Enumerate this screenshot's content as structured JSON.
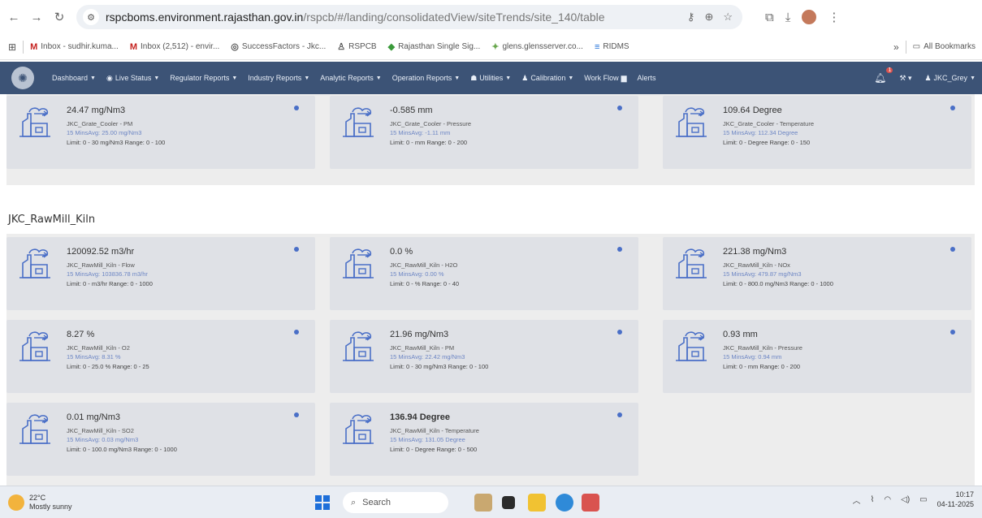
{
  "browser": {
    "url_host": "rspcboms.environment.rajasthan.gov.in",
    "url_path": "/rspcb/#/landing/consolidatedView/siteTrends/site_140/table",
    "bookmarks": [
      {
        "icon": "M",
        "label": "Inbox - sudhir.kuma..."
      },
      {
        "icon": "M",
        "label": "Inbox (2,512) - envir..."
      },
      {
        "icon": "◎",
        "label": "SuccessFactors - Jkc..."
      },
      {
        "icon": "♙",
        "label": "RSPCB"
      },
      {
        "icon": "◆",
        "label": "Rajasthan Single Sig..."
      },
      {
        "icon": "✦",
        "label": "glens.glensserver.co..."
      },
      {
        "icon": "≡",
        "label": "RIDMS"
      }
    ],
    "more_bookmarks": "»",
    "all_bookmarks": "All Bookmarks"
  },
  "nav": {
    "items": [
      {
        "label": "Dashboard",
        "caret": true
      },
      {
        "label": "Live Status",
        "caret": true,
        "icon": "◉"
      },
      {
        "label": "Regulator Reports",
        "caret": true
      },
      {
        "label": "Industry Reports",
        "caret": true
      },
      {
        "label": "Analytic Reports",
        "caret": true
      },
      {
        "label": "Operation Reports",
        "caret": true
      },
      {
        "label": "Utilities",
        "caret": true,
        "icon": "☗"
      },
      {
        "label": "Calibration",
        "caret": true,
        "icon": "♟"
      },
      {
        "label": "Work Flow",
        "caret": false
      },
      {
        "label": "Alerts",
        "caret": false
      }
    ],
    "bell_badge": "1",
    "user": "JKC_Grey"
  },
  "top_group": [
    {
      "value": "24.47 mg/Nm3",
      "name": "JKC_Grate_Cooler - PM",
      "avg": "15 MinsAvg: 25.00 mg/Nm3",
      "limit": "Limit: 0 - 30 mg/Nm3  Range: 0 - 100"
    },
    {
      "value": "-0.585 mm",
      "name": "JKC_Grate_Cooler - Pressure",
      "avg": "15 MinsAvg: -1.11 mm",
      "limit": "Limit: 0 - mm  Range: 0 - 200"
    },
    {
      "value": "109.64 Degree",
      "name": "JKC_Grate_Cooler - Temperature",
      "avg": "15 MinsAvg: 112.34 Degree",
      "limit": "Limit: 0 - Degree  Range: 0 - 150"
    }
  ],
  "section_title": "JKC_RawMill_Kiln",
  "kiln_group": [
    {
      "value": "120092.52 m3/hr",
      "name": "JKC_RawMill_Kiln - Flow",
      "avg": "15 MinsAvg: 103836.78 m3/hr",
      "limit": "Limit: 0 - m3/hr  Range: 0 - 1000"
    },
    {
      "value": "0.0 %",
      "name": "JKC_RawMill_Kiln - H2O",
      "avg": "15 MinsAvg: 0.00 %",
      "limit": "Limit: 0 - %  Range: 0 - 40"
    },
    {
      "value": "221.38 mg/Nm3",
      "name": "JKC_RawMill_Kiln - NOx",
      "avg": "15 MinsAvg: 479.87 mg/Nm3",
      "limit": "Limit: 0 - 800.0 mg/Nm3  Range: 0 - 1000"
    },
    {
      "value": "8.27 %",
      "name": "JKC_RawMill_Kiln - O2",
      "avg": "15 MinsAvg: 8.31 %",
      "limit": "Limit: 0 - 25.0 %  Range: 0 - 25"
    },
    {
      "value": "21.96 mg/Nm3",
      "name": "JKC_RawMill_Kiln - PM",
      "avg": "15 MinsAvg: 22.42 mg/Nm3",
      "limit": "Limit: 0 - 30 mg/Nm3  Range: 0 - 100"
    },
    {
      "value": "0.93 mm",
      "name": "JKC_RawMill_Kiln - Pressure",
      "avg": "15 MinsAvg: 0.94 mm",
      "limit": "Limit: 0 - mm  Range: 0 - 200"
    },
    {
      "value": "0.01 mg/Nm3",
      "name": "JKC_RawMill_Kiln - SO2",
      "avg": "15 MinsAvg: 0.03 mg/Nm3",
      "limit": "Limit: 0 - 100.0 mg/Nm3  Range: 0 - 1000"
    },
    {
      "value": "136.94 Degree",
      "name": "JKC_RawMill_Kiln - Temperature",
      "avg": "15 MinsAvg: 131.05 Degree",
      "limit": "Limit: 0 - Degree  Range: 0 - 500"
    }
  ],
  "taskbar": {
    "temp": "22°C",
    "weather": "Mostly sunny",
    "search": "Search",
    "time": "10:17",
    "date": "04-11-2025"
  }
}
